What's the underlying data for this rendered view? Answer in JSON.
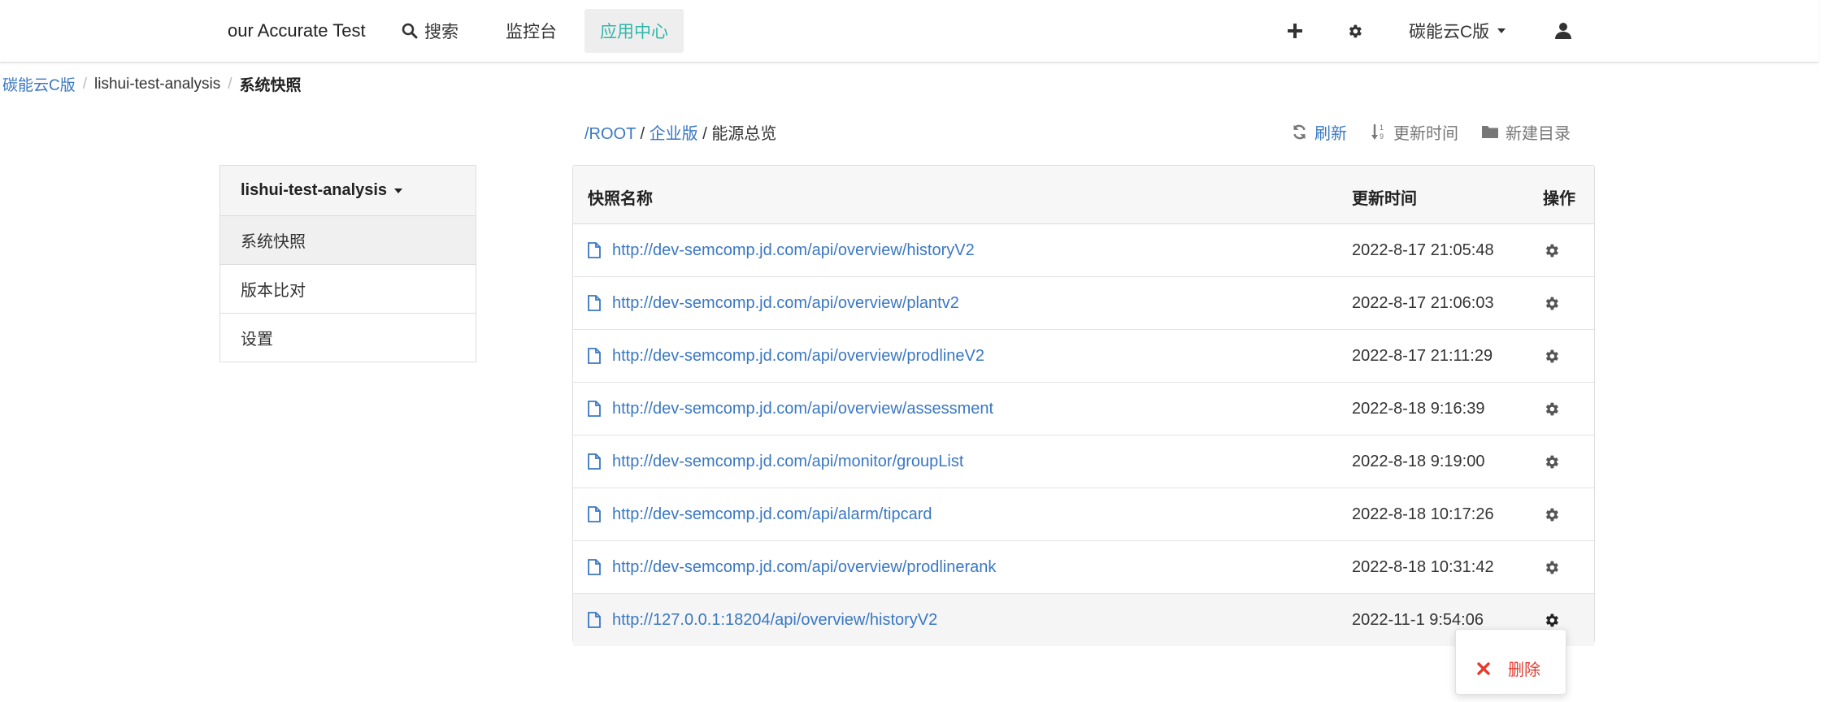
{
  "navbar": {
    "brand": "our Accurate Test",
    "search_label": "搜索",
    "console_label": "监控台",
    "app_center_label": "应用中心",
    "tenant_label": "碳能云C版",
    "accent_color": "#2fb7a9"
  },
  "breadcrumb": {
    "items": [
      "碳能云C版",
      "lishui-test-analysis",
      "系统快照"
    ]
  },
  "side_panel": {
    "project": "lishui-test-analysis",
    "items": [
      "系统快照",
      "版本比对",
      "设置"
    ]
  },
  "path": {
    "root": "/ROOT",
    "sep": "/",
    "enterprise": "企业版",
    "current": "能源总览"
  },
  "toolbar": {
    "refresh": "刷新",
    "sort_time": "更新时间",
    "new_dir": "新建目录"
  },
  "table": {
    "headers": {
      "name": "快照名称",
      "time": "更新时间",
      "op": "操作"
    },
    "rows": [
      {
        "name": "http://dev-semcomp.jd.com/api/overview/historyV2",
        "time": "2022-8-17 21:05:48"
      },
      {
        "name": "http://dev-semcomp.jd.com/api/overview/plantv2",
        "time": "2022-8-17 21:06:03"
      },
      {
        "name": "http://dev-semcomp.jd.com/api/overview/prodlineV2",
        "time": "2022-8-17 21:11:29"
      },
      {
        "name": "http://dev-semcomp.jd.com/api/overview/assessment",
        "time": "2022-8-18 9:16:39"
      },
      {
        "name": "http://dev-semcomp.jd.com/api/monitor/groupList",
        "time": "2022-8-18 9:19:00"
      },
      {
        "name": "http://dev-semcomp.jd.com/api/alarm/tipcard",
        "time": "2022-8-18 10:17:26"
      },
      {
        "name": "http://dev-semcomp.jd.com/api/overview/prodlinerank",
        "time": "2022-8-18 10:31:42"
      },
      {
        "name": "http://127.0.0.1:18204/api/overview/historyV2",
        "time": "2022-11-1 9:54:06"
      }
    ]
  },
  "dropdown": {
    "delete_label": "删除",
    "delete_color": "#e43b30"
  }
}
